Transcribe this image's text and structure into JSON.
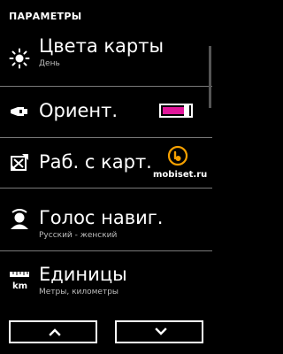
{
  "screen": {
    "title": "ПАРАМЕТРЫ"
  },
  "items": [
    {
      "title": "Цвета карты",
      "subtitle": "День",
      "icon": "sun-icon"
    },
    {
      "title": "Ориент.",
      "icon": "compass-car-icon",
      "toggle_on": true,
      "accent_color": "#e0169a"
    },
    {
      "title": "Раб. с карт.",
      "icon": "map-tools-icon"
    },
    {
      "title": "Голос навиг.",
      "subtitle": "Русский - женский",
      "icon": "voice-person-icon"
    },
    {
      "title": "Единицы",
      "subtitle": "Метры, километры",
      "icon": "ruler-km-icon"
    }
  ],
  "watermark": {
    "text": "mobiset.ru",
    "color": "#f5a000"
  },
  "navigation": {
    "up_icon": "chevron-up-icon",
    "down_icon": "chevron-down-icon"
  }
}
